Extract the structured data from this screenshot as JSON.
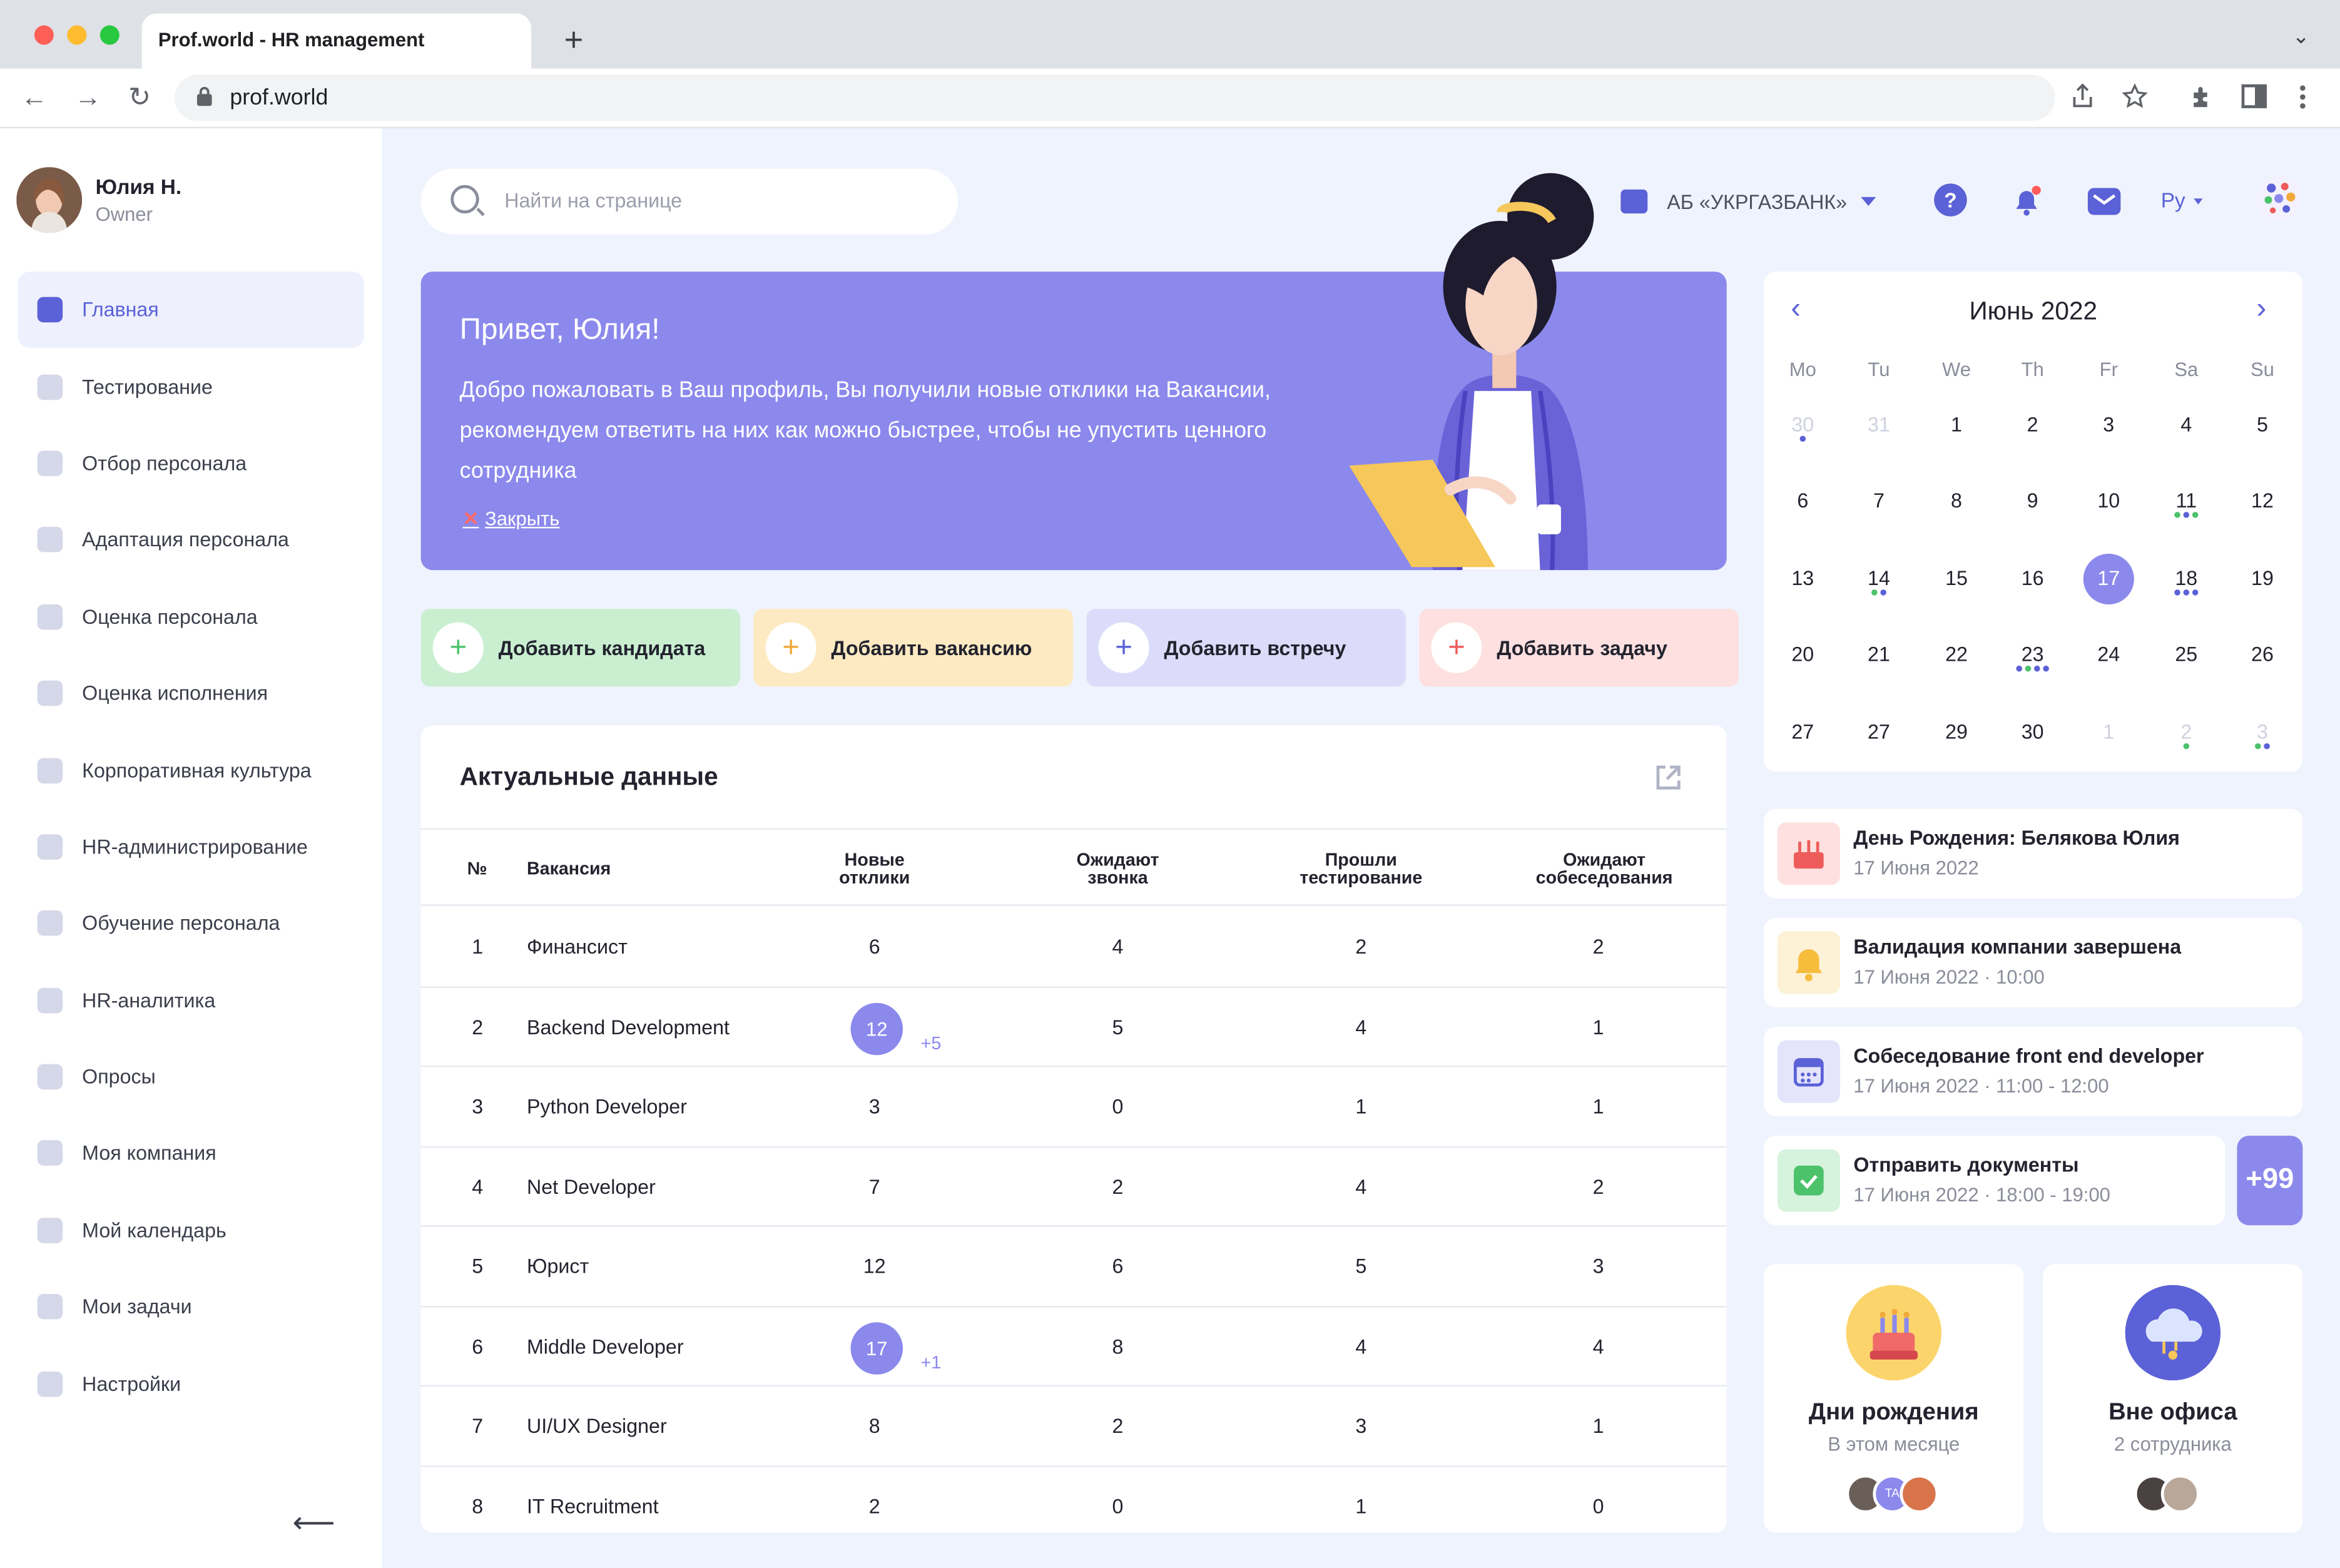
{
  "browser": {
    "tab_title": "Prof.world  - HR management",
    "url": "prof.world"
  },
  "user": {
    "name": "Юлия Н.",
    "role": "Owner"
  },
  "sidebar": {
    "items": [
      {
        "label": "Главная",
        "icon": "home-icon",
        "active": true
      },
      {
        "label": "Тестирование",
        "icon": "clipboard-icon"
      },
      {
        "label": "Отбор персонала",
        "icon": "people-icon"
      },
      {
        "label": "Адаптация персонала",
        "icon": "heart-icon"
      },
      {
        "label": "Оценка персонала",
        "icon": "users-icon"
      },
      {
        "label": "Оценка исполнения",
        "icon": "person-icon"
      },
      {
        "label": "Корпоративная культура",
        "icon": "gamepad-icon"
      },
      {
        "label": "HR-администрирование",
        "icon": "list-icon"
      },
      {
        "label": "Обучение персонала",
        "icon": "graduation-cap-icon"
      },
      {
        "label": "HR-аналитика",
        "icon": "bar-chart-icon"
      },
      {
        "label": "Опросы",
        "icon": "document-icon"
      },
      {
        "label": "Моя компания",
        "icon": "building-icon"
      },
      {
        "label": "Мой календарь",
        "icon": "calendar-icon"
      },
      {
        "label": "Мои задачи",
        "icon": "check-icon"
      },
      {
        "label": "Настройки",
        "icon": "gear-icon"
      }
    ]
  },
  "header": {
    "search_placeholder": "Найти на странице",
    "company": "АБ «УКРГАЗБАНК»",
    "help": "?",
    "language": "Ру"
  },
  "banner": {
    "greeting": "Привет, Юлия!",
    "message": "Добро пожаловать в Ваш профиль, Вы получили новые отклики на Вакансии, рекомендуем ответить на них как можно быстрее, чтобы не упустить ценного сотрудника",
    "close_label": "Закрыть"
  },
  "actions": [
    {
      "label": "Добавить кандидата",
      "bg": "#c9efd0",
      "plus_color": "#4cc26b"
    },
    {
      "label": "Добавить вакансию",
      "bg": "#fdeac2",
      "plus_color": "#f2a93b"
    },
    {
      "label": "Добавить встречу",
      "bg": "#dcdcfa",
      "plus_color": "#5b61d6"
    },
    {
      "label": "Добавить задачу",
      "bg": "#fde0df",
      "plus_color": "#ee5b5b"
    }
  ],
  "table": {
    "title": "Актуальные данные",
    "columns": [
      "№",
      "Вакансия",
      "Новые\nотклики",
      "Ожидают\nзвонка",
      "Прошли\nтестирование",
      "Ожидают\nсобеседования"
    ],
    "rows": [
      {
        "n": "1",
        "name": "Финансист",
        "new": "6",
        "badge": false,
        "delta": "",
        "call": "4",
        "tested": "2",
        "interview": "2"
      },
      {
        "n": "2",
        "name": "Backend Development",
        "new": "12",
        "badge": true,
        "delta": "+5",
        "call": "5",
        "tested": "4",
        "interview": "1"
      },
      {
        "n": "3",
        "name": "Python Developer",
        "new": "3",
        "badge": false,
        "delta": "",
        "call": "0",
        "tested": "1",
        "interview": "1"
      },
      {
        "n": "4",
        "name": "Net Developer",
        "new": "7",
        "badge": false,
        "delta": "",
        "call": "2",
        "tested": "4",
        "interview": "2"
      },
      {
        "n": "5",
        "name": "Юрист",
        "new": "12",
        "badge": false,
        "delta": "",
        "call": "6",
        "tested": "5",
        "interview": "3"
      },
      {
        "n": "6",
        "name": "Middle Developer",
        "new": "17",
        "badge": true,
        "delta": "+1",
        "call": "8",
        "tested": "4",
        "interview": "4"
      },
      {
        "n": "7",
        "name": "UI/UX Designer",
        "new": "8",
        "badge": false,
        "delta": "",
        "call": "2",
        "tested": "3",
        "interview": "1"
      },
      {
        "n": "8",
        "name": "IT Recruitment",
        "new": "2",
        "badge": false,
        "delta": "",
        "call": "0",
        "tested": "1",
        "interview": "0"
      }
    ]
  },
  "calendar": {
    "month": "Июнь 2022",
    "weekdays": [
      "Mo",
      "Tu",
      "We",
      "Th",
      "Fr",
      "Sa",
      "Su"
    ],
    "weeks": [
      [
        {
          "d": "30",
          "m": true,
          "dots": [
            "#5b61d6"
          ]
        },
        {
          "d": "31",
          "m": true
        },
        {
          "d": "1"
        },
        {
          "d": "2"
        },
        {
          "d": "3"
        },
        {
          "d": "4"
        },
        {
          "d": "5"
        }
      ],
      [
        {
          "d": "6"
        },
        {
          "d": "7"
        },
        {
          "d": "8"
        },
        {
          "d": "9"
        },
        {
          "d": "10"
        },
        {
          "d": "11",
          "dots": [
            "#4cc26b",
            "#5b61d6",
            "#4cc26b"
          ]
        },
        {
          "d": "12"
        }
      ],
      [
        {
          "d": "13"
        },
        {
          "d": "14",
          "dots": [
            "#4cc26b",
            "#5b61d6"
          ]
        },
        {
          "d": "15"
        },
        {
          "d": "16"
        },
        {
          "d": "17",
          "sel": true
        },
        {
          "d": "18",
          "dots": [
            "#5b61d6",
            "#5b61d6",
            "#5b61d6"
          ]
        },
        {
          "d": "19"
        }
      ],
      [
        {
          "d": "20"
        },
        {
          "d": "21"
        },
        {
          "d": "22"
        },
        {
          "d": "23",
          "dots": [
            "#5b61d6",
            "#4cc26b",
            "#5b61d6",
            "#5b61d6"
          ]
        },
        {
          "d": "24"
        },
        {
          "d": "25"
        },
        {
          "d": "26"
        }
      ],
      [
        {
          "d": "27"
        },
        {
          "d": "27"
        },
        {
          "d": "29"
        },
        {
          "d": "30"
        },
        {
          "d": "1",
          "m": true
        },
        {
          "d": "2",
          "m": true,
          "dots": [
            "#4cc26b"
          ]
        },
        {
          "d": "3",
          "m": true,
          "dots": [
            "#4cc26b",
            "#5b61d6"
          ]
        }
      ]
    ]
  },
  "events": [
    {
      "title": "День Рождения: Белякова Юлия",
      "date": "17 Июня 2022",
      "icon": "cake-icon",
      "bg": "#fde0df",
      "color": "#ee5b5b"
    },
    {
      "title": "Валидация компании завершена",
      "date": "17 Июня 2022 · 10:00",
      "icon": "bell-icon",
      "bg": "#fdf1d6",
      "color": "#f6bd3c"
    },
    {
      "title": "Собеседование front end developer",
      "date": "17 Июня 2022 · 11:00 - 12:00",
      "icon": "calendar-icon",
      "bg": "#e4e4fb",
      "color": "#5b61d6"
    },
    {
      "title": "Отправить документы",
      "date": "17 Июня 2022 · 18:00 - 19:00",
      "icon": "check-icon",
      "bg": "#d6f3dd",
      "color": "#4cc26b"
    }
  ],
  "events_more": "+99",
  "widgets": [
    {
      "title": "Дни рождения",
      "subtitle": "В этом месяце",
      "icon": "birthday-cake-icon",
      "avatar_text": "TA"
    },
    {
      "title": "Вне офиса",
      "subtitle": "2 сотрудника",
      "icon": "cloud-icon"
    }
  ]
}
